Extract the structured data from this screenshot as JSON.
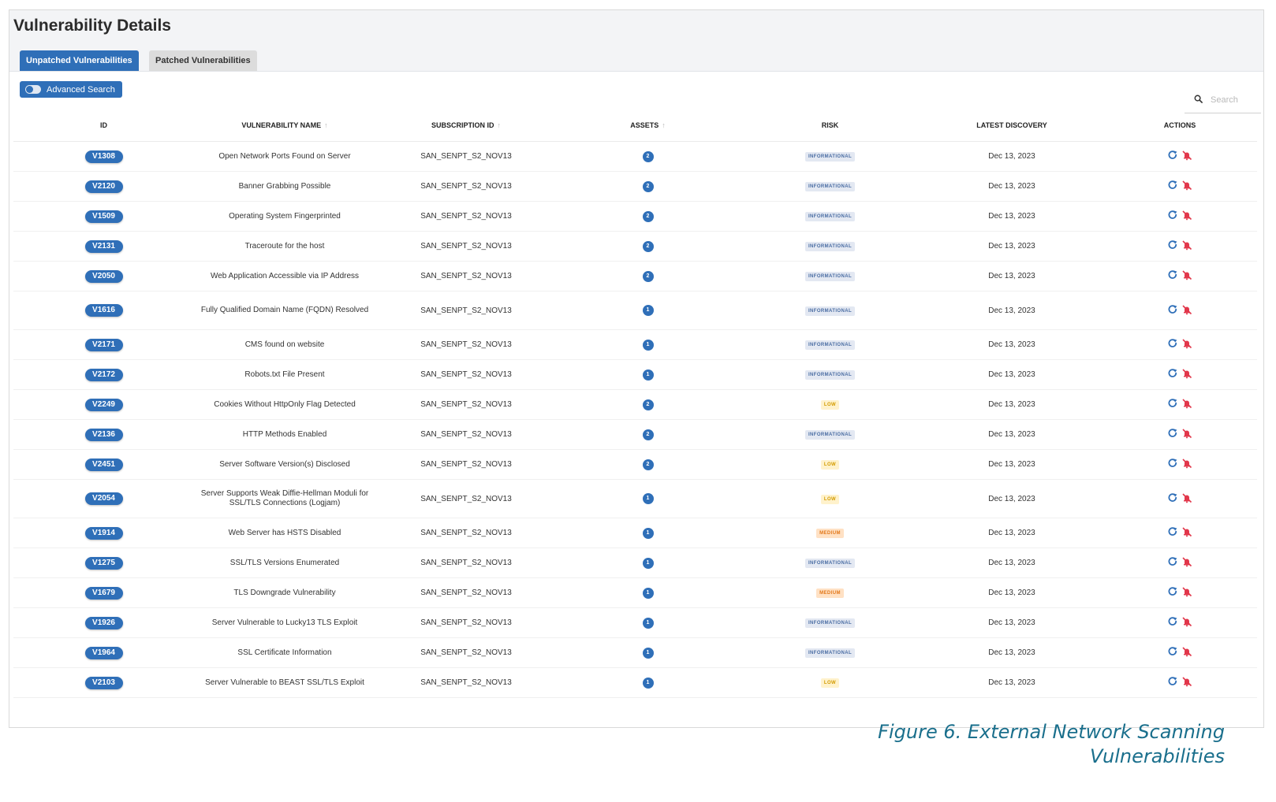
{
  "page_title": "Vulnerability Details",
  "tabs": [
    {
      "label": "Unpatched Vulnerabilities",
      "active": true
    },
    {
      "label": "Patched Vulnerabilities",
      "active": false
    }
  ],
  "advanced_search": {
    "label": "Advanced Search",
    "enabled": false
  },
  "search": {
    "placeholder": "Search",
    "value": ""
  },
  "columns": {
    "id": "ID",
    "name": "VULNERABILITY NAME",
    "subscription": "SUBSCRIPTION ID",
    "assets": "ASSETS",
    "risk": "RISK",
    "discovery": "LATEST DISCOVERY",
    "actions": "ACTIONS"
  },
  "icons": {
    "search": "search-icon",
    "sort": "sort-up-arrow-icon",
    "refresh": "refresh-icon",
    "mute": "mute-bell-icon"
  },
  "colors": {
    "accent": "#2f6fb8",
    "informational": "#4a6da3",
    "low": "#d39b00",
    "medium": "#e2781a",
    "caption": "#1a6f8c"
  },
  "rows": [
    {
      "id": "V1308",
      "name": "Open Network Ports Found on Server",
      "subscription": "SAN_SENPT_S2_NOV13",
      "assets": "2",
      "risk": "INFORMATIONAL",
      "discovery": "Dec 13, 2023"
    },
    {
      "id": "V2120",
      "name": "Banner Grabbing Possible",
      "subscription": "SAN_SENPT_S2_NOV13",
      "assets": "2",
      "risk": "INFORMATIONAL",
      "discovery": "Dec 13, 2023"
    },
    {
      "id": "V1509",
      "name": "Operating System Fingerprinted",
      "subscription": "SAN_SENPT_S2_NOV13",
      "assets": "2",
      "risk": "INFORMATIONAL",
      "discovery": "Dec 13, 2023"
    },
    {
      "id": "V2131",
      "name": "Traceroute for the host",
      "subscription": "SAN_SENPT_S2_NOV13",
      "assets": "2",
      "risk": "INFORMATIONAL",
      "discovery": "Dec 13, 2023"
    },
    {
      "id": "V2050",
      "name": "Web Application Accessible via IP Address",
      "subscription": "SAN_SENPT_S2_NOV13",
      "assets": "2",
      "risk": "INFORMATIONAL",
      "discovery": "Dec 13, 2023"
    },
    {
      "id": "V1616",
      "name": "Fully Qualified Domain Name (FQDN) Resolved",
      "subscription": "SAN_SENPT_S2_NOV13",
      "assets": "1",
      "risk": "INFORMATIONAL",
      "discovery": "Dec 13, 2023"
    },
    {
      "id": "V2171",
      "name": "CMS found on website",
      "subscription": "SAN_SENPT_S2_NOV13",
      "assets": "1",
      "risk": "INFORMATIONAL",
      "discovery": "Dec 13, 2023"
    },
    {
      "id": "V2172",
      "name": "Robots.txt File Present",
      "subscription": "SAN_SENPT_S2_NOV13",
      "assets": "1",
      "risk": "INFORMATIONAL",
      "discovery": "Dec 13, 2023"
    },
    {
      "id": "V2249",
      "name": "Cookies Without HttpOnly Flag Detected",
      "subscription": "SAN_SENPT_S2_NOV13",
      "assets": "2",
      "risk": "LOW",
      "discovery": "Dec 13, 2023"
    },
    {
      "id": "V2136",
      "name": "HTTP Methods Enabled",
      "subscription": "SAN_SENPT_S2_NOV13",
      "assets": "2",
      "risk": "INFORMATIONAL",
      "discovery": "Dec 13, 2023"
    },
    {
      "id": "V2451",
      "name": "Server Software Version(s) Disclosed",
      "subscription": "SAN_SENPT_S2_NOV13",
      "assets": "2",
      "risk": "LOW",
      "discovery": "Dec 13, 2023"
    },
    {
      "id": "V2054",
      "name": "Server Supports Weak Diffie-Hellman Moduli for SSL/TLS Connections (Logjam)",
      "subscription": "SAN_SENPT_S2_NOV13",
      "assets": "1",
      "risk": "LOW",
      "discovery": "Dec 13, 2023"
    },
    {
      "id": "V1914",
      "name": "Web Server has HSTS Disabled",
      "subscription": "SAN_SENPT_S2_NOV13",
      "assets": "1",
      "risk": "MEDIUM",
      "discovery": "Dec 13, 2023"
    },
    {
      "id": "V1275",
      "name": "SSL/TLS Versions Enumerated",
      "subscription": "SAN_SENPT_S2_NOV13",
      "assets": "1",
      "risk": "INFORMATIONAL",
      "discovery": "Dec 13, 2023"
    },
    {
      "id": "V1679",
      "name": "TLS Downgrade Vulnerability",
      "subscription": "SAN_SENPT_S2_NOV13",
      "assets": "1",
      "risk": "MEDIUM",
      "discovery": "Dec 13, 2023"
    },
    {
      "id": "V1926",
      "name": "Server Vulnerable to Lucky13 TLS Exploit",
      "subscription": "SAN_SENPT_S2_NOV13",
      "assets": "1",
      "risk": "INFORMATIONAL",
      "discovery": "Dec 13, 2023"
    },
    {
      "id": "V1964",
      "name": "SSL Certificate Information",
      "subscription": "SAN_SENPT_S2_NOV13",
      "assets": "1",
      "risk": "INFORMATIONAL",
      "discovery": "Dec 13, 2023"
    },
    {
      "id": "V2103",
      "name": "Server Vulnerable to BEAST SSL/TLS Exploit",
      "subscription": "SAN_SENPT_S2_NOV13",
      "assets": "1",
      "risk": "LOW",
      "discovery": "Dec 13, 2023"
    }
  ],
  "caption": {
    "line1": "Figure 6. External Network Scanning",
    "line2": "Vulnerabilities"
  }
}
